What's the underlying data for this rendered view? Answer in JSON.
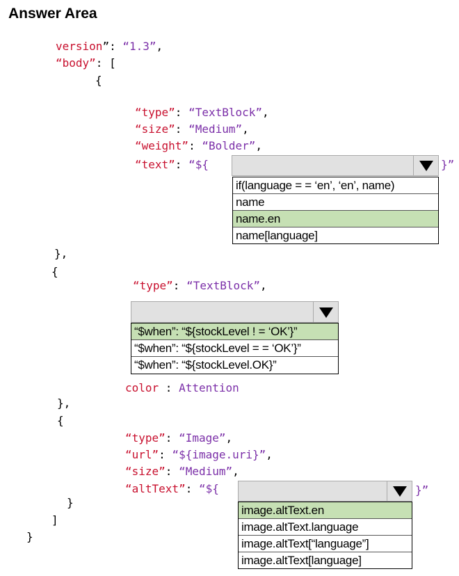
{
  "title": "Answer Area",
  "code": {
    "l1_key": "version",
    "l1_val": "“1.3”",
    "l2_key": "“body”",
    "l2_open": ": [",
    "brace_open": "{",
    "tb1_type_key": "“type”",
    "tb1_type_val": "“TextBlock”",
    "tb1_size_key": "“size”",
    "tb1_size_val": "“Medium”",
    "tb1_weight_key": "“weight”",
    "tb1_weight_val": "“Bolder”",
    "tb1_text_key": "“text”",
    "tb1_text_prefix": "“${",
    "tb1_text_suffix": "}”",
    "close1": "},",
    "open2": "{",
    "tb2_type_key": "“type”",
    "tb2_type_val": "“TextBlock”",
    "color_key": "color",
    "color_val": "Attention",
    "close2": "},",
    "open3": "{",
    "img_type_key": "“type”",
    "img_type_val": "“Image”",
    "img_url_key": "“url”",
    "img_url_val": "“${image.uri}”",
    "img_size_key": "“size”",
    "img_size_val": "“Medium”",
    "img_alt_key": "“altText”",
    "img_alt_prefix": "“${",
    "img_alt_suffix": "}”",
    "close3": "}",
    "close_arr": "]",
    "close_root": "}"
  },
  "dropdown1": {
    "options": [
      "if(language = = ‘en’, ‘en’, name)",
      "name",
      "name.en",
      "name[language]"
    ],
    "selected_index": 2
  },
  "dropdown2": {
    "options": [
      "“$when”: “${stockLevel ! = ‘OK’}”",
      "“$when”: “${stockLevel = = ‘OK’}”",
      "“$when”: “${stockLevel.OK}”"
    ],
    "selected_index": 0
  },
  "dropdown3": {
    "options": [
      "image.altText.en",
      "image.altText.language",
      "image.altText[“language”]",
      "image.altText[language]"
    ],
    "selected_index": 0
  },
  "colors": {
    "key": "#c8102e",
    "string": "#7b2fa8",
    "selected": "#c6e0b4",
    "dropdown_bg": "#e1e1e1"
  },
  "icons": {
    "dropdown_arrow": "triangle-down-icon"
  }
}
